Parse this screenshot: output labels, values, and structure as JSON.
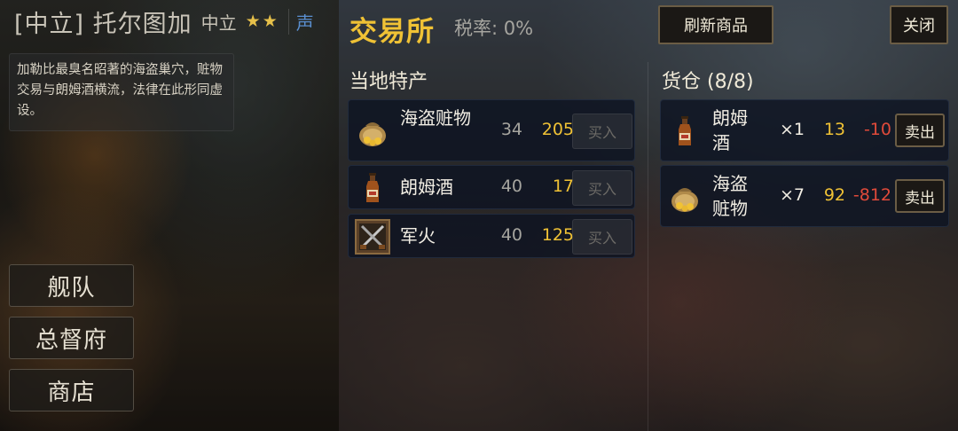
{
  "port": {
    "name": "[中立] 托尔图加",
    "stance": "中立",
    "stars": "★★",
    "reputation_label": "声",
    "description": "加勒比最臭名昭著的海盗巢穴，赃物交易与朗姆酒横流，法律在此形同虚设。"
  },
  "nav": {
    "fleet": "舰队",
    "governor": "总督府",
    "shop": "商店"
  },
  "exchange": {
    "title": "交易所",
    "tax": "税率: 0%",
    "refresh_label": "刷新商品",
    "close_label": "关闭"
  },
  "local": {
    "title": "当地特产",
    "buy_label": "买入",
    "items": [
      {
        "name": "海盗赃物",
        "icon": "loot-bag-icon",
        "qty": "34",
        "price": "205"
      },
      {
        "name": "朗姆酒",
        "icon": "rum-bottle-icon",
        "qty": "40",
        "price": "17"
      },
      {
        "name": "军火",
        "icon": "weapons-crate-icon",
        "qty": "40",
        "price": "125"
      }
    ]
  },
  "cargo": {
    "title": "货仓 (8/8)",
    "sell_label": "卖出",
    "items": [
      {
        "name": "朗姆酒",
        "icon": "rum-bottle-icon",
        "count": "×1",
        "price": "13",
        "profit": "-10"
      },
      {
        "name": "海盗赃物",
        "icon": "loot-bag-icon",
        "count": "×7",
        "price": "92",
        "profit": "-812"
      }
    ]
  },
  "colors": {
    "accent_gold": "#f0c235",
    "loss_red": "#e04a3a",
    "reputation_blue": "#5a8fd0"
  }
}
